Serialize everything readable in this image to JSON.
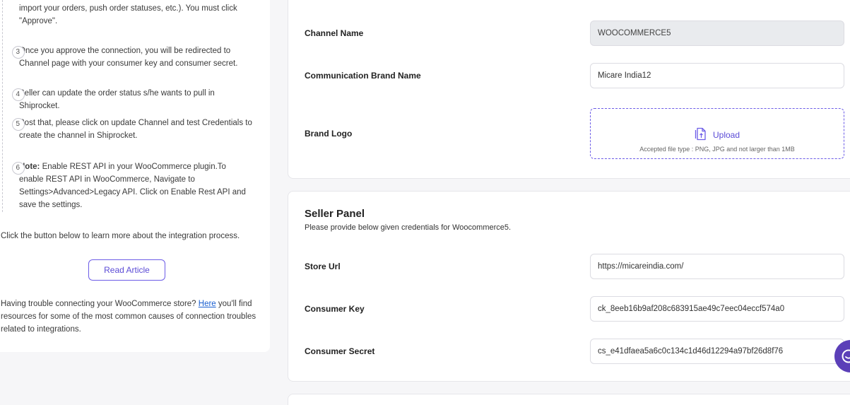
{
  "instructions": {
    "step2_tail": "import your orders, push order statuses, etc.). You must click \"Approve\".",
    "steps": [
      {
        "num": "3",
        "text": "Once you approve the connection, you will be redirected to Channel page with your consumer key and consumer secret."
      },
      {
        "num": "4",
        "text": "Seller can update the order status s/he wants to pull in Shiprocket."
      },
      {
        "num": "5",
        "text": "Post that, please click on update Channel and test Credentials to create the channel in Shiprocket."
      },
      {
        "num": "6",
        "note_label": "Note:",
        "text": " Enable REST API in your WooCommerce plugin.To enable REST API in WooCommerce, Navigate to Settings>Advanced>Legacy API. Click on Enable Rest API and save the settings."
      }
    ],
    "learn_more": "Click the button below to learn more about the integration process.",
    "read_article_button": "Read Article",
    "trouble_prefix": "Having trouble connecting your WooCommerce store? ",
    "trouble_link": "Here",
    "trouble_suffix": " you'll find resources for some of the most common causes of connection troubles related to integrations."
  },
  "channel_card": {
    "channel_name_label": "Channel Name",
    "channel_name_value": "WOOCOMMERCE5",
    "brand_name_label": "Communication Brand Name",
    "brand_name_value": "Micare India12",
    "brand_logo_label": "Brand Logo",
    "upload_label": "Upload",
    "upload_hint": "Accepted file type : PNG, JPG and not larger than 1MB"
  },
  "seller_panel": {
    "title": "Seller Panel",
    "subtitle": "Please provide below given credentials for Woocommerce5.",
    "store_url_label": "Store Url",
    "store_url_value": "https://micareindia.com/",
    "consumer_key_label": "Consumer Key",
    "consumer_key_value": "ck_8eeb16b9af208c683915ae49c7eec04eccf574a0",
    "consumer_secret_label": "Consumer Secret",
    "consumer_secret_value": "cs_e41dfaea5a6c0c134c1d46d12294a97bf26d8f76"
  },
  "icons": {
    "upload": "upload-file-icon",
    "chat": "chat-icon"
  },
  "colors": {
    "accent": "#6c5ce7",
    "link": "#1a5fd0",
    "chat": "#5b3fb8"
  }
}
